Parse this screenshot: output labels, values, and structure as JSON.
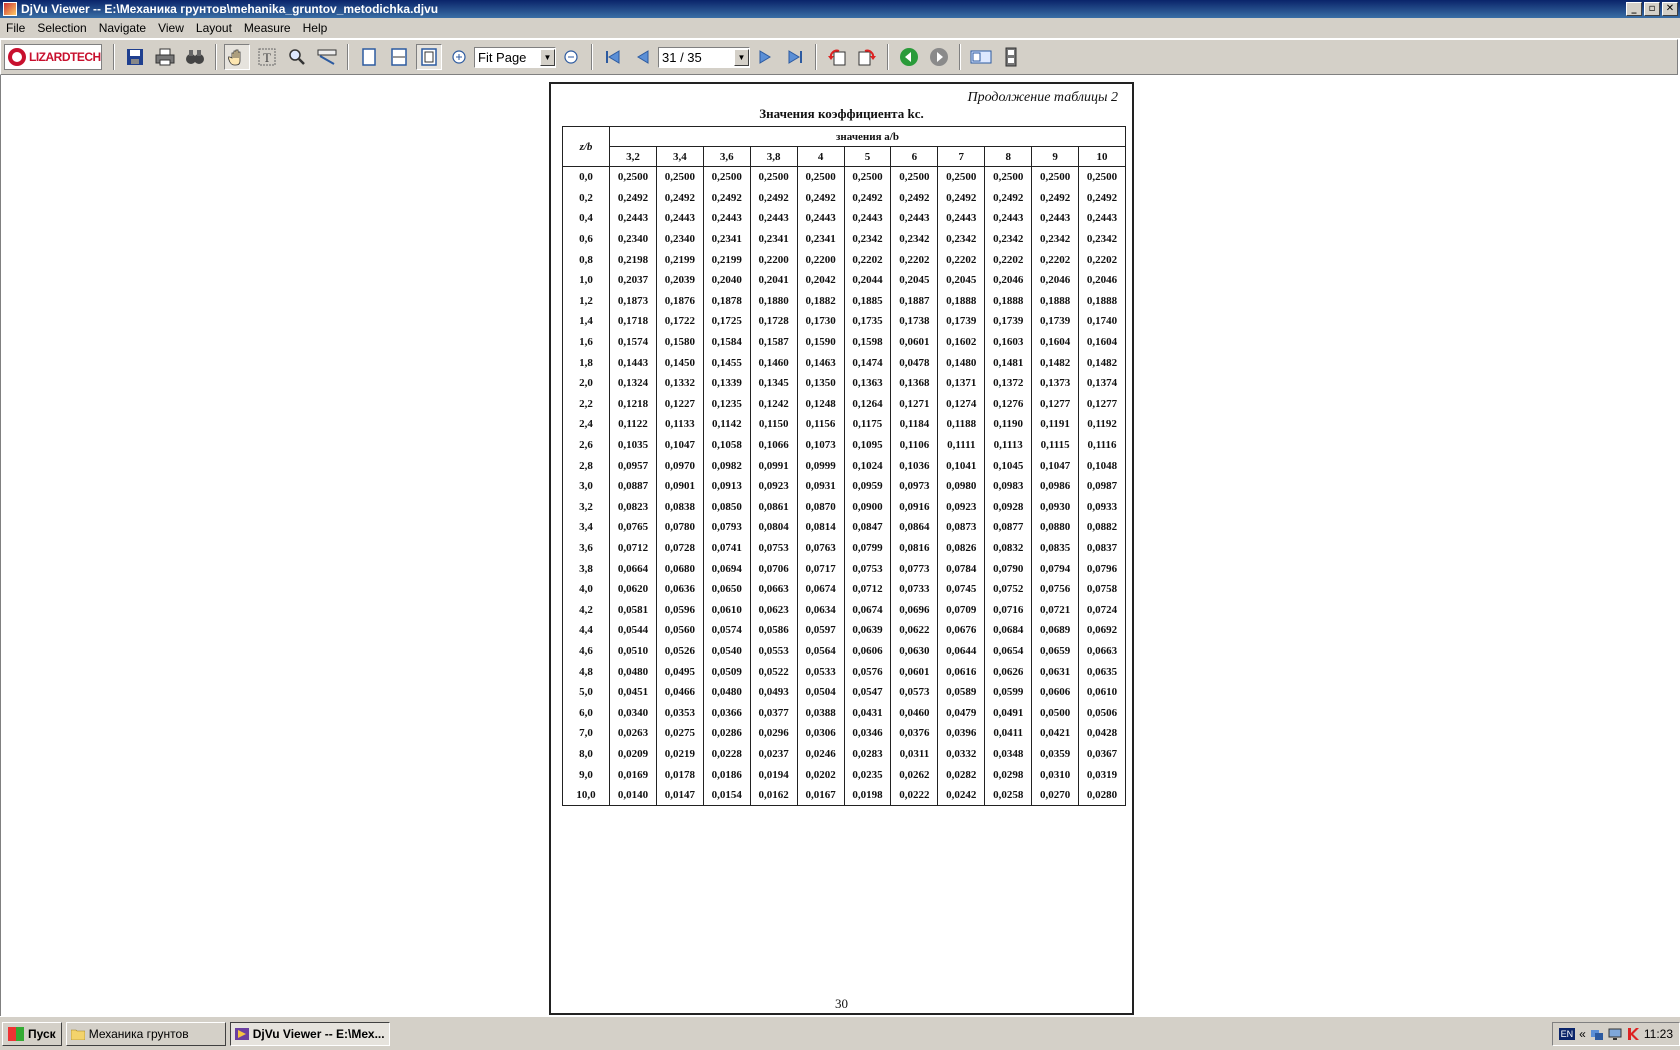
{
  "window": {
    "title": "DjVu Viewer -- E:\\Механика грунтов\\mehanika_gruntov_metodichka.djvu",
    "controls": {
      "minimize": "_",
      "maximize": "▫",
      "close": "✕"
    }
  },
  "menu": [
    "File",
    "Selection",
    "Navigate",
    "View",
    "Layout",
    "Measure",
    "Help"
  ],
  "toolbar": {
    "logo": "LIZARDTECH",
    "zoom_value": "Fit Page",
    "page_value": "31 / 35"
  },
  "document": {
    "continuation": "Продолжение таблицы 2",
    "title": "Значения коэффициента kс.",
    "page_number": "30",
    "table": {
      "row_header": "z/b",
      "group_header": "значения a/b",
      "columns": [
        "3,2",
        "3,4",
        "3,6",
        "3,8",
        "4",
        "5",
        "6",
        "7",
        "8",
        "9",
        "10"
      ],
      "rows": [
        [
          "0,0",
          "0,2500",
          "0,2500",
          "0,2500",
          "0,2500",
          "0,2500",
          "0,2500",
          "0,2500",
          "0,2500",
          "0,2500",
          "0,2500",
          "0,2500"
        ],
        [
          "0,2",
          "0,2492",
          "0,2492",
          "0,2492",
          "0,2492",
          "0,2492",
          "0,2492",
          "0,2492",
          "0,2492",
          "0,2492",
          "0,2492",
          "0,2492"
        ],
        [
          "0,4",
          "0,2443",
          "0,2443",
          "0,2443",
          "0,2443",
          "0,2443",
          "0,2443",
          "0,2443",
          "0,2443",
          "0,2443",
          "0,2443",
          "0,2443"
        ],
        [
          "0,6",
          "0,2340",
          "0,2340",
          "0,2341",
          "0,2341",
          "0,2341",
          "0,2342",
          "0,2342",
          "0,2342",
          "0,2342",
          "0,2342",
          "0,2342"
        ],
        [
          "0,8",
          "0,2198",
          "0,2199",
          "0,2199",
          "0,2200",
          "0,2200",
          "0,2202",
          "0,2202",
          "0,2202",
          "0,2202",
          "0,2202",
          "0,2202"
        ],
        [
          "1,0",
          "0,2037",
          "0,2039",
          "0,2040",
          "0,2041",
          "0,2042",
          "0,2044",
          "0,2045",
          "0,2045",
          "0,2046",
          "0,2046",
          "0,2046"
        ],
        [
          "1,2",
          "0,1873",
          "0,1876",
          "0,1878",
          "0,1880",
          "0,1882",
          "0,1885",
          "0,1887",
          "0,1888",
          "0,1888",
          "0,1888",
          "0,1888"
        ],
        [
          "1,4",
          "0,1718",
          "0,1722",
          "0,1725",
          "0,1728",
          "0,1730",
          "0,1735",
          "0,1738",
          "0,1739",
          "0,1739",
          "0,1739",
          "0,1740"
        ],
        [
          "1,6",
          "0,1574",
          "0,1580",
          "0,1584",
          "0,1587",
          "0,1590",
          "0,1598",
          "0,0601",
          "0,1602",
          "0,1603",
          "0,1604",
          "0,1604"
        ],
        [
          "1,8",
          "0,1443",
          "0,1450",
          "0,1455",
          "0,1460",
          "0,1463",
          "0,1474",
          "0,0478",
          "0,1480",
          "0,1481",
          "0,1482",
          "0,1482"
        ],
        [
          "2,0",
          "0,1324",
          "0,1332",
          "0,1339",
          "0,1345",
          "0,1350",
          "0,1363",
          "0,1368",
          "0,1371",
          "0,1372",
          "0,1373",
          "0,1374"
        ],
        [
          "2,2",
          "0,1218",
          "0,1227",
          "0,1235",
          "0,1242",
          "0,1248",
          "0,1264",
          "0,1271",
          "0,1274",
          "0,1276",
          "0,1277",
          "0,1277"
        ],
        [
          "2,4",
          "0,1122",
          "0,1133",
          "0,1142",
          "0,1150",
          "0,1156",
          "0,1175",
          "0,1184",
          "0,1188",
          "0,1190",
          "0,1191",
          "0,1192"
        ],
        [
          "2,6",
          "0,1035",
          "0,1047",
          "0,1058",
          "0,1066",
          "0,1073",
          "0,1095",
          "0,1106",
          "0,1111",
          "0,1113",
          "0,1115",
          "0,1116"
        ],
        [
          "2,8",
          "0,0957",
          "0,0970",
          "0,0982",
          "0,0991",
          "0,0999",
          "0,1024",
          "0,1036",
          "0,1041",
          "0,1045",
          "0,1047",
          "0,1048"
        ],
        [
          "3,0",
          "0,0887",
          "0,0901",
          "0,0913",
          "0,0923",
          "0,0931",
          "0,0959",
          "0,0973",
          "0,0980",
          "0,0983",
          "0,0986",
          "0,0987"
        ],
        [
          "3,2",
          "0,0823",
          "0,0838",
          "0,0850",
          "0,0861",
          "0,0870",
          "0,0900",
          "0,0916",
          "0,0923",
          "0,0928",
          "0,0930",
          "0,0933"
        ],
        [
          "3,4",
          "0,0765",
          "0,0780",
          "0,0793",
          "0,0804",
          "0,0814",
          "0,0847",
          "0,0864",
          "0,0873",
          "0,0877",
          "0,0880",
          "0,0882"
        ],
        [
          "3,6",
          "0,0712",
          "0,0728",
          "0,0741",
          "0,0753",
          "0,0763",
          "0,0799",
          "0,0816",
          "0,0826",
          "0,0832",
          "0,0835",
          "0,0837"
        ],
        [
          "3,8",
          "0,0664",
          "0,0680",
          "0,0694",
          "0,0706",
          "0,0717",
          "0,0753",
          "0,0773",
          "0,0784",
          "0,0790",
          "0,0794",
          "0,0796"
        ],
        [
          "4,0",
          "0,0620",
          "0,0636",
          "0,0650",
          "0,0663",
          "0,0674",
          "0,0712",
          "0,0733",
          "0,0745",
          "0,0752",
          "0,0756",
          "0,0758"
        ],
        [
          "4,2",
          "0,0581",
          "0,0596",
          "0,0610",
          "0,0623",
          "0,0634",
          "0,0674",
          "0,0696",
          "0,0709",
          "0,0716",
          "0,0721",
          "0,0724"
        ],
        [
          "4,4",
          "0,0544",
          "0,0560",
          "0,0574",
          "0,0586",
          "0,0597",
          "0,0639",
          "0,0622",
          "0,0676",
          "0,0684",
          "0,0689",
          "0,0692"
        ],
        [
          "4,6",
          "0,0510",
          "0,0526",
          "0,0540",
          "0,0553",
          "0,0564",
          "0,0606",
          "0,0630",
          "0,0644",
          "0,0654",
          "0,0659",
          "0,0663"
        ],
        [
          "4,8",
          "0,0480",
          "0,0495",
          "0,0509",
          "0,0522",
          "0,0533",
          "0,0576",
          "0,0601",
          "0,0616",
          "0,0626",
          "0,0631",
          "0,0635"
        ],
        [
          "5,0",
          "0,0451",
          "0,0466",
          "0,0480",
          "0,0493",
          "0,0504",
          "0,0547",
          "0,0573",
          "0,0589",
          "0,0599",
          "0,0606",
          "0,0610"
        ],
        [
          "6,0",
          "0,0340",
          "0,0353",
          "0,0366",
          "0,0377",
          "0,0388",
          "0,0431",
          "0,0460",
          "0,0479",
          "0,0491",
          "0,0500",
          "0,0506"
        ],
        [
          "7,0",
          "0,0263",
          "0,0275",
          "0,0286",
          "0,0296",
          "0,0306",
          "0,0346",
          "0,0376",
          "0,0396",
          "0,0411",
          "0,0421",
          "0,0428"
        ],
        [
          "8,0",
          "0,0209",
          "0,0219",
          "0,0228",
          "0,0237",
          "0,0246",
          "0,0283",
          "0,0311",
          "0,0332",
          "0,0348",
          "0,0359",
          "0,0367"
        ],
        [
          "9,0",
          "0,0169",
          "0,0178",
          "0,0186",
          "0,0194",
          "0,0202",
          "0,0235",
          "0,0262",
          "0,0282",
          "0,0298",
          "0,0310",
          "0,0319"
        ],
        [
          "10,0",
          "0,0140",
          "0,0147",
          "0,0154",
          "0,0162",
          "0,0167",
          "0,0198",
          "0,0222",
          "0,0242",
          "0,0258",
          "0,0270",
          "0,0280"
        ]
      ]
    }
  },
  "taskbar": {
    "start": "Пуск",
    "tasks": [
      {
        "label": "Механика грунтов",
        "active": false
      },
      {
        "label": "DjVu Viewer -- E:\\Мех...",
        "active": true
      }
    ],
    "tray": {
      "lang": "EN",
      "chevron": "«",
      "clock": "11:23"
    }
  }
}
